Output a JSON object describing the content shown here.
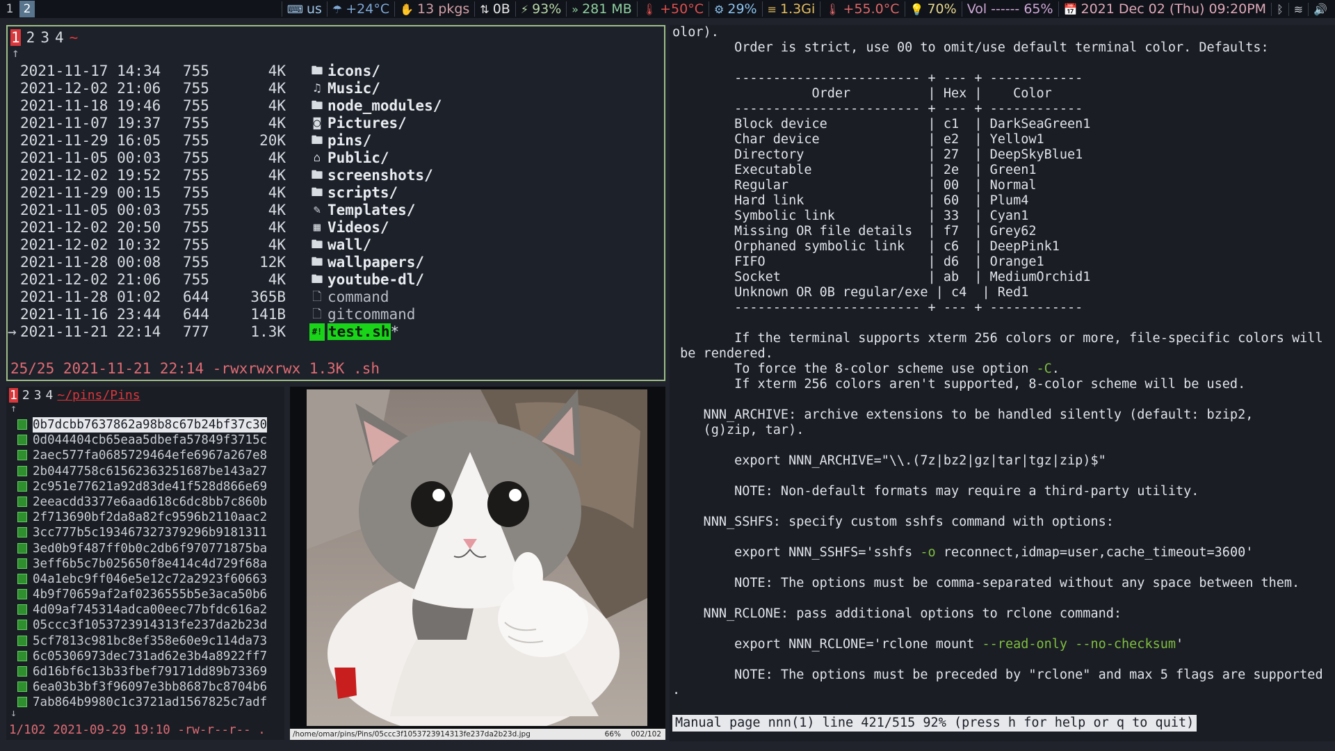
{
  "bar": {
    "workspaces": [
      "1",
      "2"
    ],
    "active_workspace": "2",
    "modules": [
      {
        "icon": "keyboard-icon",
        "glyph": "⌨",
        "text": "us",
        "color": "#9ec5e8"
      },
      {
        "icon": "weather-icon",
        "glyph": "☂",
        "text": "+24°C",
        "color": "#7ea9d8"
      },
      {
        "icon": "package-icon",
        "glyph": "✋",
        "text": "13 pkgs",
        "color": "#d5a0a8"
      },
      {
        "icon": "ipc-icon",
        "glyph": "⇅",
        "text": "0B",
        "color": "#e8e8e8"
      },
      {
        "icon": "battery-icon",
        "glyph": "⚡",
        "text": "93%",
        "color": "#b8d8a8"
      },
      {
        "icon": "memory-icon",
        "glyph": "»",
        "text": "281 MB",
        "color": "#8fd0a0"
      },
      {
        "icon": "cpu-temp-icon",
        "glyph": "🌡",
        "text": "+50°C",
        "color": "#e05050"
      },
      {
        "icon": "cpu-icon",
        "glyph": "⚙",
        "text": "29%",
        "color": "#8cc4f0"
      },
      {
        "icon": "ram-icon",
        "glyph": "≡",
        "text": "1.3Gi",
        "color": "#e8c060"
      },
      {
        "icon": "temperature-icon",
        "glyph": "🌡",
        "text": "+55.0°C",
        "color": "#e06868"
      },
      {
        "icon": "brightness-icon",
        "glyph": "💡",
        "text": "70%",
        "color": "#e8d890"
      },
      {
        "icon": "volume-icon",
        "glyph": "",
        "text": "Vol ------ 65%",
        "color": "#d0a8d8"
      },
      {
        "icon": "calendar-icon",
        "glyph": "📅",
        "text": "2021 Dec 02 (Thu) 09:20PM",
        "color": "#e0a8b8"
      },
      {
        "icon": "bluetooth-icon",
        "glyph": "ᛒ",
        "text": "",
        "color": "#c8ccd2"
      },
      {
        "icon": "wifi-icon",
        "glyph": "≋",
        "text": "",
        "color": "#c8ccd2"
      },
      {
        "icon": "speaker-icon",
        "glyph": "🔊",
        "text": "",
        "color": "#c8ccd2"
      }
    ]
  },
  "nnn": {
    "contexts": [
      "1",
      "2",
      "3",
      "4"
    ],
    "path": "~",
    "up_arrow": "↑",
    "files": [
      {
        "date": "2021-11-17 14:34",
        "perm": "755",
        "size": "4K",
        "icon": "folder-icon",
        "glyph": "🖿",
        "name": "icons/",
        "type": "dir"
      },
      {
        "date": "2021-12-02 21:06",
        "perm": "755",
        "size": "4K",
        "icon": "music-note-icon",
        "glyph": "♫",
        "name": "Music/",
        "type": "dir"
      },
      {
        "date": "2021-11-18 19:46",
        "perm": "755",
        "size": "4K",
        "icon": "folder-icon",
        "glyph": "🖿",
        "name": "node_modules/",
        "type": "dir"
      },
      {
        "date": "2021-11-07 19:37",
        "perm": "755",
        "size": "4K",
        "icon": "camera-icon",
        "glyph": "◙",
        "name": "Pictures/",
        "type": "dir"
      },
      {
        "date": "2021-11-29 16:05",
        "perm": "755",
        "size": "20K",
        "icon": "folder-icon",
        "glyph": "🖿",
        "name": "pins/",
        "type": "dir"
      },
      {
        "date": "2021-11-05 00:03",
        "perm": "755",
        "size": "4K",
        "icon": "inbox-icon",
        "glyph": "⌂",
        "name": "Public/",
        "type": "dir"
      },
      {
        "date": "2021-12-02 19:52",
        "perm": "755",
        "size": "4K",
        "icon": "folder-icon",
        "glyph": "🖿",
        "name": "screenshots/",
        "type": "dir"
      },
      {
        "date": "2021-11-29 00:15",
        "perm": "755",
        "size": "4K",
        "icon": "folder-icon",
        "glyph": "🖿",
        "name": "scripts/",
        "type": "dir"
      },
      {
        "date": "2021-11-05 00:03",
        "perm": "755",
        "size": "4K",
        "icon": "paperclip-icon",
        "glyph": "✎",
        "name": "Templates/",
        "type": "dir"
      },
      {
        "date": "2021-12-02 20:50",
        "perm": "755",
        "size": "4K",
        "icon": "film-icon",
        "glyph": "▦",
        "name": "Videos/",
        "type": "dir"
      },
      {
        "date": "2021-12-02 10:32",
        "perm": "755",
        "size": "4K",
        "icon": "folder-icon",
        "glyph": "🖿",
        "name": "wall/",
        "type": "dir"
      },
      {
        "date": "2021-11-28 00:08",
        "perm": "755",
        "size": "12K",
        "icon": "folder-icon",
        "glyph": "🖿",
        "name": "wallpapers/",
        "type": "dir"
      },
      {
        "date": "2021-12-02 21:06",
        "perm": "755",
        "size": "4K",
        "icon": "folder-icon",
        "glyph": "🖿",
        "name": "youtube-dl/",
        "type": "dir"
      },
      {
        "date": "2021-11-28 01:02",
        "perm": "644",
        "size": "365B",
        "icon": "file-icon",
        "glyph": "🗋",
        "name": "command",
        "type": "file"
      },
      {
        "date": "2021-11-16 23:44",
        "perm": "644",
        "size": "141B",
        "icon": "file-icon",
        "glyph": "🗋",
        "name": "gitcommand",
        "type": "file"
      },
      {
        "date": "2021-11-21 22:14",
        "perm": "777",
        "size": "1.3K",
        "icon": "script-icon",
        "glyph": "#!",
        "name": "test.sh",
        "suffix": "*",
        "type": "exe",
        "current": true
      }
    ],
    "status": "25/25 2021-11-21 22:14 -rwxrwxrwx 1.3K .sh"
  },
  "pins": {
    "contexts": [
      "1",
      "2",
      "3",
      "4"
    ],
    "path": "~/pins/Pins",
    "up_arrow": "↑",
    "down_arrow": "↓",
    "files": [
      "0b7dcbb7637862a98b8c67b24bf37c30",
      "0d044404cb65eaa5dbefa57849f3715c",
      "2aec577fa0685729464efe6967a267e8",
      "2b0447758c61562363251687be143a27",
      "2c951e77621a92d83de41f528d866e69",
      "2eeacdd3377e6aad618c6dc8bb7c860b",
      "2f713690bf2da8a82fc9596b2110aac2",
      "3cc777b5c193467327379296b9181311",
      "3ed0b9f487ff0b0c2db6f970771875ba",
      "3eff6b5c7b025650f8e414c4d729f68a",
      "04a1ebc9ff046e5e12c72a2923f60663",
      "4b9f70659af2af0236555b5e3aca50b6",
      "4d09af745314adca00eec77bfdc616a2",
      "05ccc3f1053723914313fe237da2b23d",
      "5cf7813c981bc8ef358e60e9c114da73",
      "6c05306973dec731ad62e3b4a8922ff7",
      "6d16bf6c13b33fbef79171dd89b73369",
      "6ea03b3bf3f96097e3bb8687bc8704b6",
      "7ab864b9980c1c3721ad1567825c7adf"
    ],
    "status": "1/102 2021-09-29 19:10 -rw-r--r-- ."
  },
  "preview": {
    "path": "/home/omar/pins/Pins/05ccc3f1053723914313fe237da2b23d.jpg",
    "zoom": "66%",
    "index": "002/102"
  },
  "man": {
    "lines": [
      "olor).",
      "        Order is strict, use 00 to omit/use default terminal color. Defaults:",
      "",
      "        ------------------------ + --- + ------------",
      "                  Order          | Hex |    Color",
      "        ------------------------ + --- + ------------",
      "        Block device             | c1  | DarkSeaGreen1",
      "        Char device              | e2  | Yellow1",
      "        Directory                | 27  | DeepSkyBlue1",
      "        Executable               | 2e  | Green1",
      "        Regular                  | 00  | Normal",
      "        Hard link                | 60  | Plum4",
      "        Symbolic link            | 33  | Cyan1",
      "        Missing OR file details  | f7  | Grey62",
      "        Orphaned symbolic link   | c6  | DeepPink1",
      "        FIFO                     | d6  | Orange1",
      "        Socket                   | ab  | MediumOrchid1",
      "        Unknown OR 0B regular/exe | c4  | Red1",
      "        ------------------------ + --- + ------------",
      "",
      "        If the terminal supports xterm 256 colors or more, file-specific colors will",
      " be rendered.",
      "        To force the 8-color scheme use option -C.",
      "        If xterm 256 colors aren't supported, 8-color scheme will be used.",
      "",
      "    NNN_ARCHIVE: archive extensions to be handled silently (default: bzip2,",
      "    (g)zip, tar).",
      "",
      "        export NNN_ARCHIVE=\"\\\\.(7z|bz2|gz|tar|tgz|zip)$\"",
      "",
      "        NOTE: Non-default formats may require a third-party utility.",
      "",
      "    NNN_SSHFS: specify custom sshfs command with options:",
      "",
      "        export NNN_SSHFS='sshfs -o reconnect,idmap=user,cache_timeout=3600'",
      "",
      "        NOTE: The options must be comma-separated without any space between them.",
      "",
      "    NNN_RCLONE: pass additional options to rclone command:",
      "",
      "        export NNN_RCLONE='rclone mount --read-only --no-checksum'",
      "",
      "        NOTE: The options must be preceded by \"rclone\" and max 5 flags are supported",
      "."
    ],
    "highlights": [
      "-C",
      "-o",
      "--read-only",
      "--no-checksum"
    ],
    "status": "Manual page nnn(1) line 421/515 92% (press h for help or q to quit)"
  }
}
